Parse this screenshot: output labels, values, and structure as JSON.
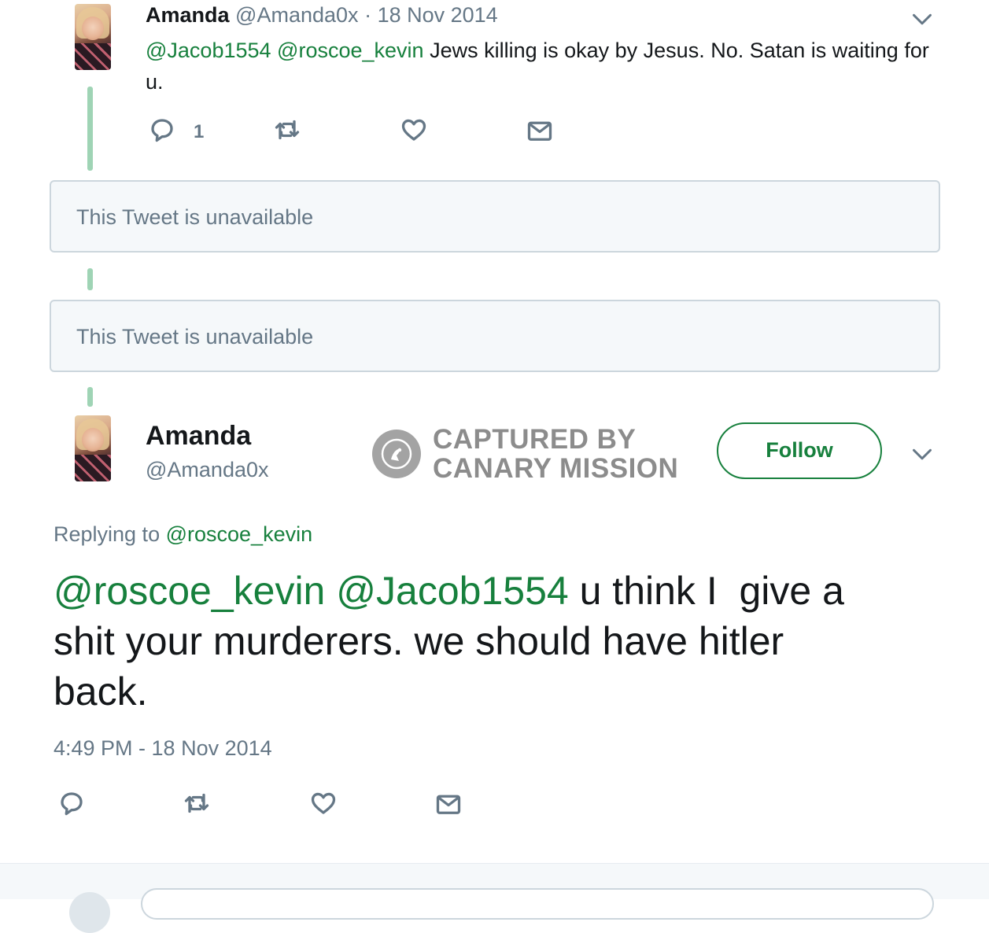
{
  "first_tweet": {
    "author_name": "Amanda",
    "author_handle": "@Amanda0x",
    "date_separator": "·",
    "date": "18 Nov 2014",
    "mention_1": "@Jacob1554",
    "mention_2": "@roscoe_kevin",
    "text_line_1": "Jews killing is okay by Jesus. No. Satan is waiting for",
    "text_line_2": "u.",
    "reply_count": "1"
  },
  "unavailable": [
    {
      "text": "This Tweet is unavailable"
    },
    {
      "text": "This Tweet is unavailable"
    }
  ],
  "main_tweet": {
    "author_name": "Amanda",
    "author_handle": "@Amanda0x",
    "follow_label": "Follow",
    "replying_to_prefix": "Replying to",
    "replying_to_handle": "@roscoe_kevin",
    "mention_1": "@roscoe_kevin",
    "mention_2": "@Jacob1554",
    "line_1_rest": "u think I  give a",
    "line_2": "shit your murderers. we should have hitler",
    "line_3": "back.",
    "timestamp": "4:49 PM - 18 Nov 2014"
  },
  "watermark": {
    "line_1": "CAPTURED BY",
    "line_2": "CANARY MISSION"
  },
  "colors": {
    "link": "#17803d",
    "muted": "#657786",
    "thread_line": "#9fd4b5",
    "border": "#ccd6dd"
  },
  "icons": [
    "reply-icon",
    "retweet-icon",
    "like-icon",
    "message-icon",
    "chevron-down-icon",
    "canary-logo-icon"
  ]
}
